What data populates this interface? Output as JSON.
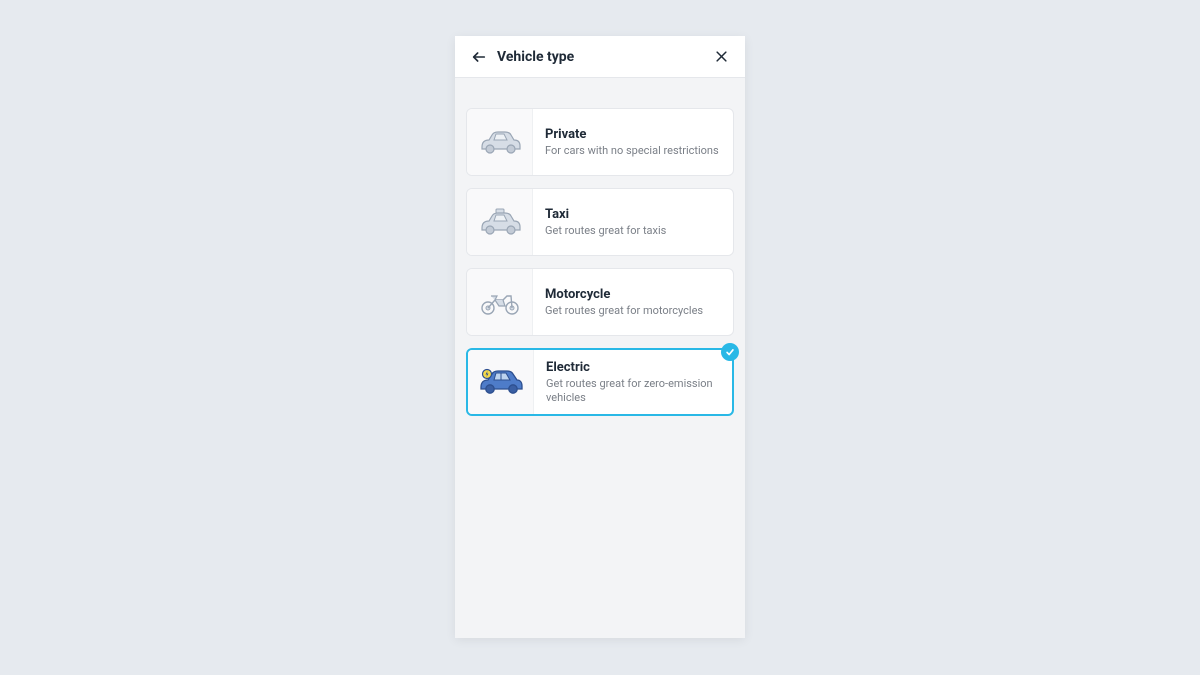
{
  "header": {
    "title": "Vehicle type"
  },
  "options": [
    {
      "id": "private",
      "title": "Private",
      "desc": "For cars with no special restrictions",
      "selected": false,
      "icon": "car-icon"
    },
    {
      "id": "taxi",
      "title": "Taxi",
      "desc": "Get routes great for taxis",
      "selected": false,
      "icon": "taxi-icon"
    },
    {
      "id": "motorcycle",
      "title": "Motorcycle",
      "desc": "Get routes great for motorcycles",
      "selected": false,
      "icon": "motorcycle-icon"
    },
    {
      "id": "electric",
      "title": "Electric",
      "desc": "Get routes great for zero-emission vehicles",
      "selected": true,
      "icon": "electric-car-icon"
    }
  ],
  "colors": {
    "accent": "#29b8e6",
    "icon_muted_fill": "#d6dde6",
    "icon_muted_stroke": "#9aa6b5",
    "icon_selected_fill": "#4e7cc9",
    "icon_selected_stroke": "#2d4f8f"
  }
}
